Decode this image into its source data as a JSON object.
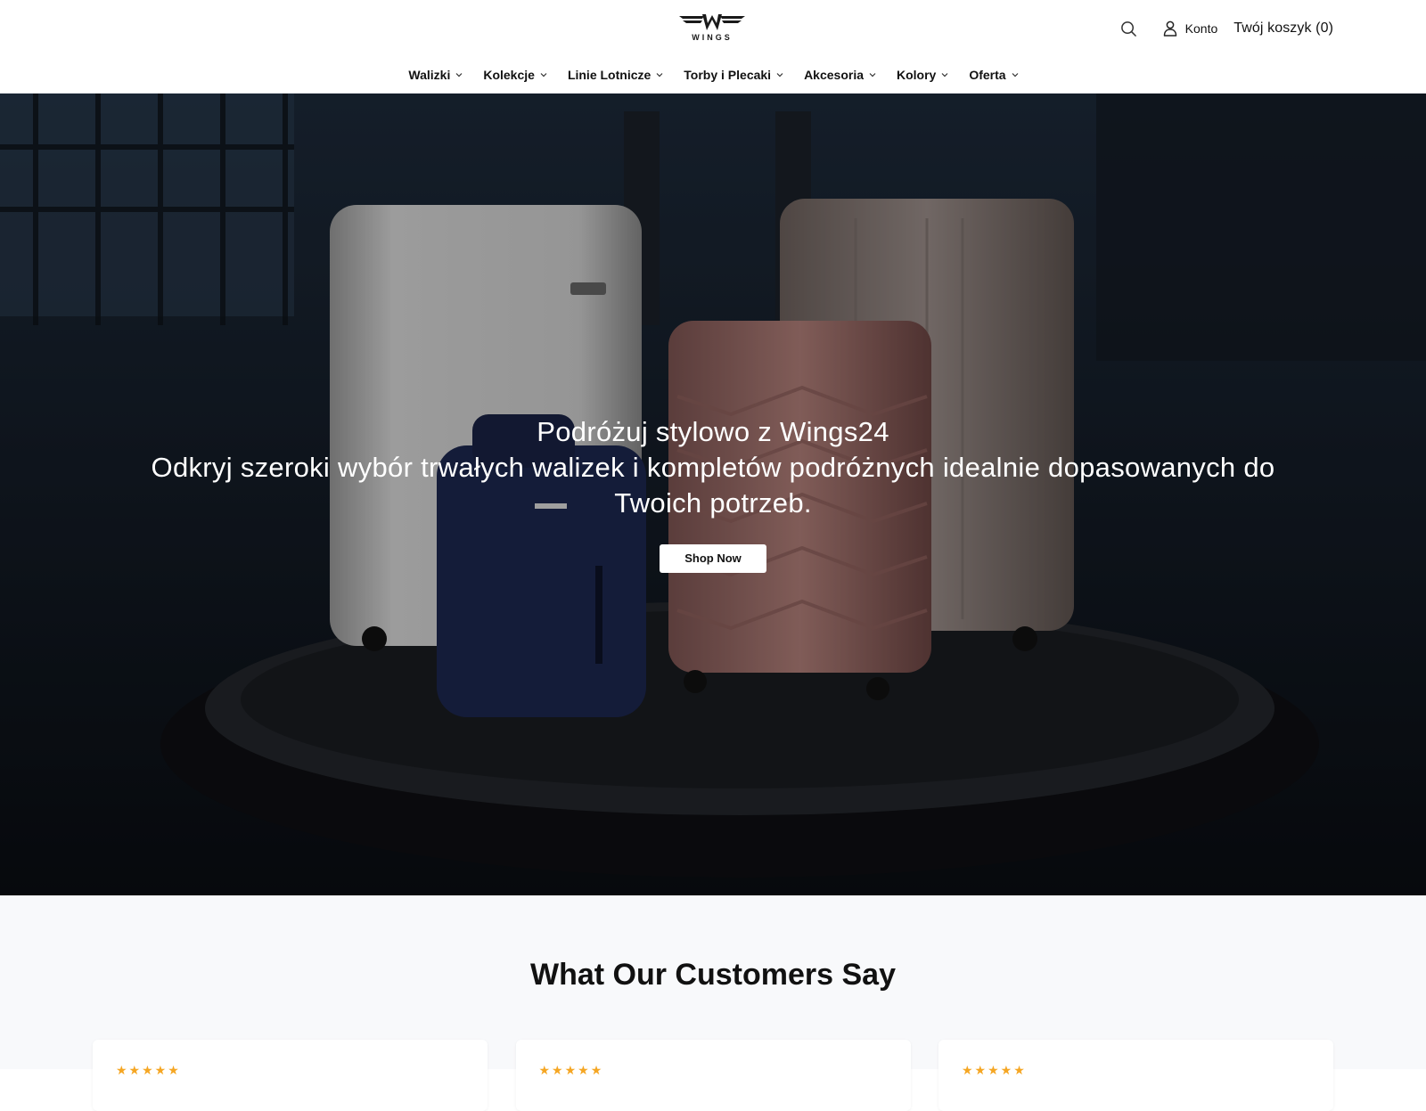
{
  "brand": {
    "logo_text": "WINGS"
  },
  "header": {
    "account_label": "Konto",
    "cart_label": "Twój koszyk (0)"
  },
  "nav": {
    "items": [
      {
        "label": "Walizki"
      },
      {
        "label": "Kolekcje"
      },
      {
        "label": "Linie Lotnicze"
      },
      {
        "label": "Torby i Plecaki"
      },
      {
        "label": "Akcesoria"
      },
      {
        "label": "Kolory"
      },
      {
        "label": "Oferta"
      }
    ]
  },
  "hero": {
    "title": "Podróżuj stylowo z Wings24",
    "subtitle": "Odkryj szeroki wybór trwałych walizek i kompletów podróżnych idealnie dopasowanych do Twoich potrzeb.",
    "cta_label": "Shop Now"
  },
  "testimonials": {
    "title": "What Our Customers Say",
    "cards": [
      {
        "stars": "★★★★★"
      },
      {
        "stars": "★★★★★"
      },
      {
        "stars": "★★★★★"
      }
    ]
  },
  "colors": {
    "accent_star": "#f5a623",
    "hero_overlay": "#000000",
    "section_bg": "#f8f9fb"
  },
  "icons": [
    "search-icon",
    "user-icon",
    "chevron-down-icon",
    "wings-logo"
  ]
}
